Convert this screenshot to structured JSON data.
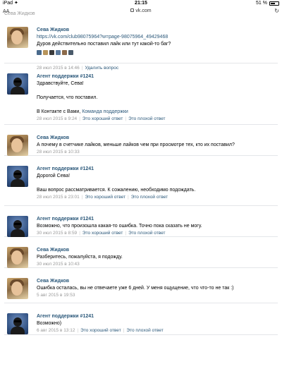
{
  "status": {
    "left": "iPad ✦",
    "time": "21:15",
    "battery": "51 %",
    "battery_level": 0.51
  },
  "browser": {
    "url": "vk.com",
    "lock_icon": "lock-icon",
    "left_icon": "text-size-icon",
    "right_icon": "reload-icon"
  },
  "cut_text": "Сева Жидков",
  "messages": [
    {
      "type": "user",
      "author": "Сева Жидков",
      "link": "https://vk.com/club98075964?w=page-98075964_49429468",
      "text": "Дуров действительно поставил лайк или тут какой-то баг?",
      "thumb_colors": [
        "#4a6a8c",
        "#b8955c",
        "#3b3b3b",
        "#5c7a9c",
        "#8c6a4a",
        "#4a5a6a"
      ],
      "date": "28 июл 2015 в 14:46",
      "action": "Удалить вопрос"
    },
    {
      "type": "support",
      "author": "Агент поддержки #1241",
      "lines": [
        "Здравствуйте, Сева!",
        "",
        "Получается, что поставил.",
        ""
      ],
      "sign_prefix": "В Контакте с Вами, ",
      "sign_link": "Команда поддержки",
      "date": "28 июл 2015 в 9:24",
      "good": "Это хороший ответ",
      "bad": "Это плохой ответ"
    },
    {
      "type": "user",
      "author": "Сева Жидков",
      "text": "А почему в счетчике лайков, меньше лайков чем при просмотре тех, кто их поставил?",
      "date": "28 июл 2015 в 10:33"
    },
    {
      "type": "support",
      "author": "Агент поддержки #1241",
      "lines": [
        "Дорогой Сева!",
        "",
        "Ваш вопрос рассматривается. К сожалению, необходимо подождать."
      ],
      "date": "28 июл 2015 в 23:01",
      "good": "Это хороший ответ",
      "bad": "Это плохой ответ"
    },
    {
      "type": "support",
      "author": "Агент поддержки #1241",
      "lines": [
        "Возможно, что произошла какая-то ошибка. Точно пока сказать не могу."
      ],
      "date": "30 июл 2015 в 8:59",
      "good": "Это хороший ответ",
      "bad": "Это плохой ответ"
    },
    {
      "type": "user",
      "author": "Сева Жидков",
      "text": "Разберитесь, пожалуйста, я подожду.",
      "date": "30 июл 2015 в 10:43"
    },
    {
      "type": "user",
      "author": "Сева Жидков",
      "text": "Ошибка осталась, вы не отвечаете уже 6 дней. У меня ощущение, что что-то не так :)",
      "date": "5 авг 2015 в 19:53"
    },
    {
      "type": "support",
      "author": "Агент поддержки #1241",
      "lines": [
        "Возможно)"
      ],
      "date": "6 авг 2015 в 13:12",
      "good": "Это хороший ответ",
      "bad": "Это плохой ответ"
    }
  ]
}
